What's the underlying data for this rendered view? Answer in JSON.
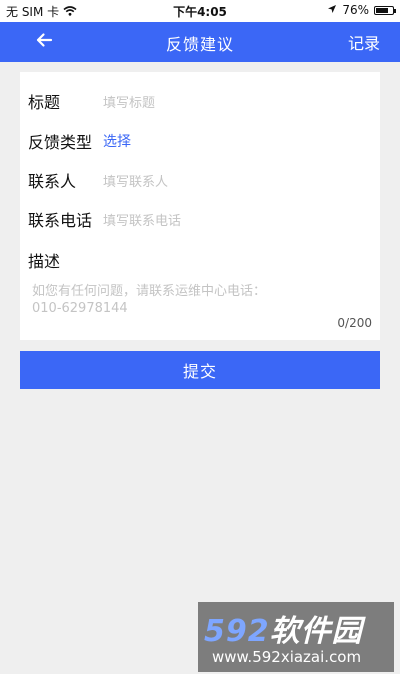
{
  "status_bar": {
    "carrier": "无 SIM 卡",
    "time": "下午4:05",
    "battery": "76%",
    "battery_level": 0.76
  },
  "nav": {
    "back_icon": "arrow-left-icon",
    "title": "反馈建议",
    "right_label": "记录"
  },
  "form": {
    "title_label": "标题",
    "title_placeholder": "填写标题",
    "type_label": "反馈类型",
    "type_value": "选择",
    "contact_label": "联系人",
    "contact_placeholder": "填写联系人",
    "phone_label": "联系电话",
    "phone_placeholder": "填写联系电话",
    "desc_label": "描述",
    "desc_placeholder_line1": "如您有任何问题，请联系运维中心电话：",
    "desc_placeholder_line2": "010-62978144",
    "counter": "0/200"
  },
  "submit_label": "提交",
  "watermark": {
    "number": "592",
    "text": "软件园",
    "url": "www.592xiazai.com"
  },
  "colors": {
    "accent": "#3b67f6",
    "background": "#efefef"
  }
}
